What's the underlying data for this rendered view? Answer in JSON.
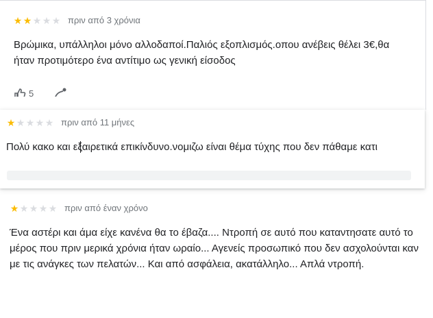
{
  "reviews": [
    {
      "rating": 2,
      "max_rating": 5,
      "time": "πριν από 3 χρόνια",
      "text": "Βρώμικα, υπάλληλοι μόνο αλλοδαποί.Παλιός εξοπλισμός.οπου ανέβεις θέλει 3€,θα ήταν προτιμότερο ένα αντίτιμο ως γενική είσοδος",
      "likes": "5",
      "like_icon": "thumbs-up-icon",
      "share_icon": "share-icon"
    },
    {
      "rating": 1,
      "max_rating": 5,
      "time": "πριν από 11 μήνες",
      "text": "Πολύ κακο και εξαιρετικά επικίνδυνο.νομιζω είναι θέμα τύχης που δεν πάθαμε κατι"
    },
    {
      "rating": 1,
      "max_rating": 5,
      "time": "πριν από έναν χρόνο",
      "text": "Ένα αστέρι και άμα είχε κανένα θα το έβαζα.... Ντροπή σε αυτό που καταντησατε αυτό το μέρος που πριν μερικά χρόνια ήταν ωραίο... Αγενείς προσωπικό που δεν ασχολούνται καν με τις ανάγκες των πελατών... Και από ασφάλεια, ακατάλληλο... Απλά ντροπή."
    }
  ],
  "colors": {
    "star_on": "#fbbc04",
    "star_off": "#dadce0",
    "meta_text": "#70757a"
  }
}
